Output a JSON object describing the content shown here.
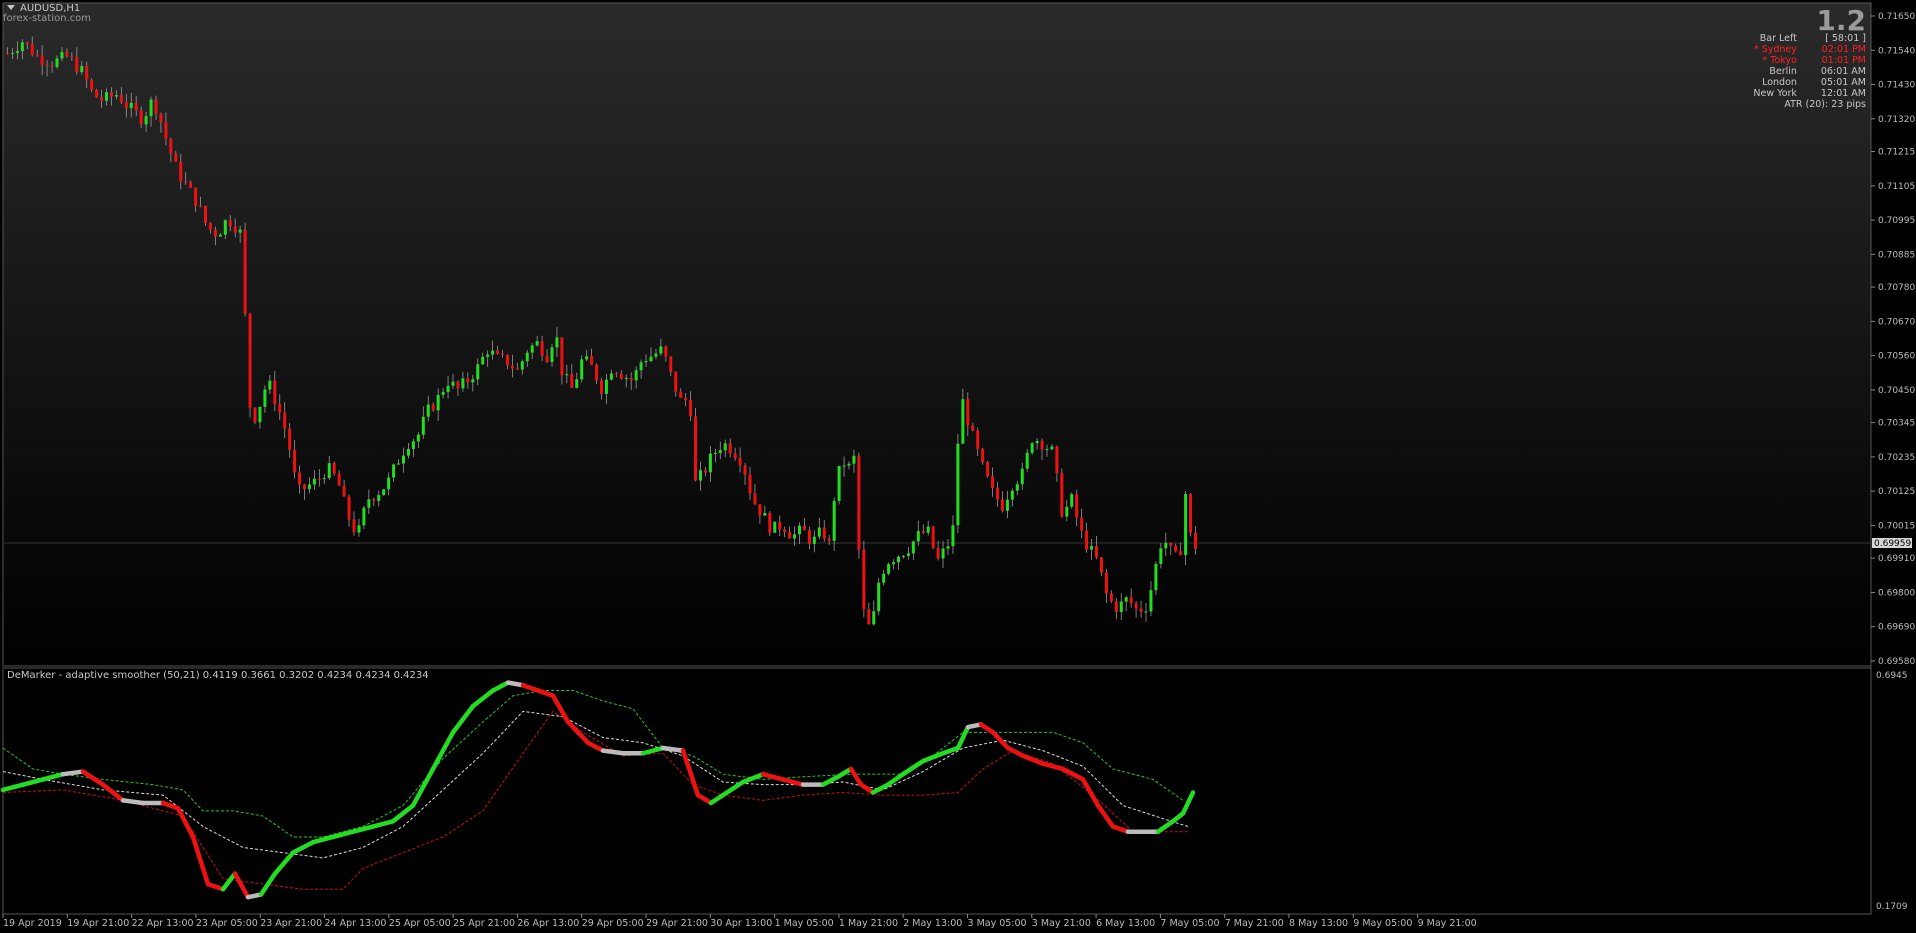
{
  "chart": {
    "symbol": "AUDUSD,H1",
    "source": "forex-station.com",
    "version": "1.2"
  },
  "info_panel": {
    "rows": [
      {
        "label": "Bar Left",
        "value": "[ 58:01 ]",
        "color": "#c8c8c8"
      },
      {
        "label": "* Sydney",
        "value": "02:01 PM",
        "color": "#ff2020"
      },
      {
        "label": "* Tokyo",
        "value": "01:01 PM",
        "color": "#ff2020"
      },
      {
        "label": "Berlin",
        "value": "06:01 AM",
        "color": "#c8c8c8"
      },
      {
        "label": "London",
        "value": "05:01 AM",
        "color": "#c8c8c8"
      },
      {
        "label": "New York",
        "value": "12:01 AM",
        "color": "#c8c8c8"
      }
    ],
    "atr": "ATR (20): 23 pips"
  },
  "indicator": {
    "label": "DeMarker - adaptive smoother (50,21) 0.4119 0.3661 0.3202 0.4234 0.4234 0.4234",
    "scale_top": "0.6945",
    "scale_bottom": "0.1709"
  },
  "price_axis": {
    "labels": [
      "0.71650",
      "0.71540",
      "0.71430",
      "0.71320",
      "0.71215",
      "0.71105",
      "0.70995",
      "0.70885",
      "0.70780",
      "0.70670",
      "0.70560",
      "0.70450",
      "0.70345",
      "0.70235",
      "0.70125",
      "0.70015",
      "0.69910",
      "0.69800",
      "0.69690",
      "0.69580"
    ],
    "current_price": "0.69959"
  },
  "time_axis": {
    "labels": [
      "19 Apr 2019",
      "19 Apr 21:00",
      "22 Apr 13:00",
      "23 Apr 05:00",
      "23 Apr 21:00",
      "24 Apr 13:00",
      "25 Apr 05:00",
      "25 Apr 21:00",
      "26 Apr 13:00",
      "29 Apr 05:00",
      "29 Apr 21:00",
      "30 Apr 13:00",
      "1 May 05:00",
      "1 May 21:00",
      "2 May 13:00",
      "3 May 05:00",
      "3 May 21:00",
      "6 May 13:00",
      "7 May 05:00",
      "7 May 21:00",
      "8 May 13:00",
      "9 May 05:00",
      "9 May 21:00"
    ]
  },
  "colors": {
    "bull": "#22dd22",
    "bear": "#ee1111",
    "neutral_line": "#bbbbbb",
    "background_top": "#2a2a2a",
    "background_bottom": "#000000"
  },
  "chart_data": {
    "type": "candlestick",
    "close_path": [
      [
        0,
        0.7153
      ],
      [
        15,
        0.7157
      ],
      [
        30,
        0.7152
      ],
      [
        45,
        0.715
      ],
      [
        60,
        0.7152
      ],
      [
        75,
        0.7147
      ],
      [
        85,
        0.714
      ],
      [
        95,
        0.7138
      ],
      [
        110,
        0.714
      ],
      [
        120,
        0.7136
      ],
      [
        135,
        0.7132
      ],
      [
        145,
        0.7138
      ],
      [
        150,
        0.7135
      ],
      [
        160,
        0.7124
      ],
      [
        170,
        0.7115
      ],
      [
        180,
        0.711
      ],
      [
        190,
        0.7105
      ],
      [
        200,
        0.7097
      ],
      [
        210,
        0.7095
      ],
      [
        220,
        0.71
      ],
      [
        230,
        0.7097
      ],
      [
        235,
        0.7094
      ],
      [
        240,
        0.7045
      ],
      [
        245,
        0.7035
      ],
      [
        250,
        0.7038
      ],
      [
        260,
        0.7048
      ],
      [
        270,
        0.704
      ],
      [
        280,
        0.703
      ],
      [
        290,
        0.7012
      ],
      [
        300,
        0.7014
      ],
      [
        310,
        0.7016
      ],
      [
        320,
        0.702
      ],
      [
        330,
        0.7016
      ],
      [
        340,
        0.7005
      ],
      [
        350,
        0.6998
      ],
      [
        360,
        0.701
      ],
      [
        370,
        0.7012
      ],
      [
        380,
        0.7015
      ],
      [
        390,
        0.7022
      ],
      [
        400,
        0.7028
      ],
      [
        410,
        0.703
      ],
      [
        420,
        0.7038
      ],
      [
        430,
        0.7042
      ],
      [
        440,
        0.7048
      ],
      [
        450,
        0.7045
      ],
      [
        460,
        0.7048
      ],
      [
        470,
        0.7052
      ],
      [
        480,
        0.7058
      ],
      [
        490,
        0.7055
      ],
      [
        500,
        0.7054
      ],
      [
        510,
        0.7051
      ],
      [
        520,
        0.7058
      ],
      [
        530,
        0.706
      ],
      [
        540,
        0.7056
      ],
      [
        548,
        0.7064
      ],
      [
        555,
        0.705
      ],
      [
        565,
        0.7045
      ],
      [
        575,
        0.7055
      ],
      [
        585,
        0.7052
      ],
      [
        595,
        0.7045
      ],
      [
        605,
        0.7053
      ],
      [
        615,
        0.705
      ],
      [
        625,
        0.7048
      ],
      [
        635,
        0.7055
      ],
      [
        645,
        0.7056
      ],
      [
        655,
        0.7058
      ],
      [
        665,
        0.7048
      ],
      [
        675,
        0.704
      ],
      [
        682,
        0.7044
      ],
      [
        688,
        0.7015
      ],
      [
        695,
        0.7018
      ],
      [
        705,
        0.7024
      ],
      [
        715,
        0.7028
      ],
      [
        725,
        0.7026
      ],
      [
        735,
        0.7022
      ],
      [
        745,
        0.701
      ],
      [
        755,
        0.7005
      ],
      [
        765,
        0.7
      ],
      [
        775,
        0.7002
      ],
      [
        785,
        0.6998
      ],
      [
        795,
        0.7
      ],
      [
        805,
        0.6996
      ],
      [
        815,
        0.7
      ],
      [
        822,
        0.6995
      ],
      [
        828,
        0.7015
      ],
      [
        835,
        0.7022
      ],
      [
        842,
        0.702
      ],
      [
        848,
        0.7024
      ],
      [
        852,
        0.6988
      ],
      [
        858,
        0.6968
      ],
      [
        865,
        0.697
      ],
      [
        872,
        0.6985
      ],
      [
        880,
        0.699
      ],
      [
        890,
        0.6992
      ],
      [
        900,
        0.6994
      ],
      [
        910,
        0.6998
      ],
      [
        920,
        0.7
      ],
      [
        930,
        0.699
      ],
      [
        940,
        0.6995
      ],
      [
        948,
        0.7003
      ],
      [
        952,
        0.7045
      ],
      [
        958,
        0.7038
      ],
      [
        965,
        0.703
      ],
      [
        975,
        0.702
      ],
      [
        985,
        0.7012
      ],
      [
        995,
        0.7008
      ],
      [
        1005,
        0.7015
      ],
      [
        1015,
        0.7018
      ],
      [
        1025,
        0.703
      ],
      [
        1035,
        0.7028
      ],
      [
        1045,
        0.7025
      ],
      [
        1055,
        0.7005
      ],
      [
        1065,
        0.701
      ],
      [
        1072,
        0.7
      ],
      [
        1080,
        0.6995
      ],
      [
        1090,
        0.699
      ],
      [
        1100,
        0.6978
      ],
      [
        1110,
        0.6975
      ],
      [
        1120,
        0.6978
      ],
      [
        1130,
        0.6974
      ],
      [
        1140,
        0.6976
      ],
      [
        1148,
        0.6988
      ],
      [
        1155,
        0.6998
      ],
      [
        1165,
        0.6992
      ],
      [
        1172,
        0.699
      ],
      [
        1178,
        0.7012
      ],
      [
        1183,
        0.6998
      ],
      [
        1188,
        0.6995
      ]
    ]
  },
  "demarker_data": {
    "main_line": [
      [
        0,
        0.59
      ],
      [
        20,
        0.6
      ],
      [
        40,
        0.61
      ],
      [
        60,
        0.62
      ],
      [
        80,
        0.625
      ],
      [
        100,
        0.6
      ],
      [
        120,
        0.57
      ],
      [
        140,
        0.565
      ],
      [
        160,
        0.565
      ],
      [
        175,
        0.555
      ],
      [
        190,
        0.5
      ],
      [
        205,
        0.41
      ],
      [
        220,
        0.4
      ],
      [
        232,
        0.43
      ],
      [
        245,
        0.385
      ],
      [
        258,
        0.39
      ],
      [
        272,
        0.43
      ],
      [
        290,
        0.47
      ],
      [
        310,
        0.49
      ],
      [
        330,
        0.5
      ],
      [
        350,
        0.51
      ],
      [
        370,
        0.52
      ],
      [
        390,
        0.53
      ],
      [
        410,
        0.56
      ],
      [
        430,
        0.63
      ],
      [
        450,
        0.7
      ],
      [
        470,
        0.75
      ],
      [
        490,
        0.78
      ],
      [
        505,
        0.795
      ],
      [
        520,
        0.79
      ],
      [
        535,
        0.78
      ],
      [
        550,
        0.77
      ],
      [
        565,
        0.72
      ],
      [
        585,
        0.68
      ],
      [
        600,
        0.665
      ],
      [
        620,
        0.66
      ],
      [
        640,
        0.66
      ],
      [
        660,
        0.67
      ],
      [
        680,
        0.665
      ],
      [
        695,
        0.58
      ],
      [
        708,
        0.565
      ],
      [
        720,
        0.58
      ],
      [
        740,
        0.605
      ],
      [
        760,
        0.62
      ],
      [
        780,
        0.61
      ],
      [
        800,
        0.6
      ],
      [
        820,
        0.6
      ],
      [
        835,
        0.615
      ],
      [
        848,
        0.63
      ],
      [
        858,
        0.6
      ],
      [
        870,
        0.585
      ],
      [
        885,
        0.6
      ],
      [
        900,
        0.62
      ],
      [
        920,
        0.645
      ],
      [
        940,
        0.66
      ],
      [
        955,
        0.67
      ],
      [
        965,
        0.71
      ],
      [
        978,
        0.715
      ],
      [
        990,
        0.7
      ],
      [
        1005,
        0.67
      ],
      [
        1020,
        0.655
      ],
      [
        1040,
        0.64
      ],
      [
        1060,
        0.63
      ],
      [
        1080,
        0.61
      ],
      [
        1095,
        0.56
      ],
      [
        1110,
        0.52
      ],
      [
        1125,
        0.51
      ],
      [
        1140,
        0.51
      ],
      [
        1155,
        0.51
      ],
      [
        1170,
        0.53
      ],
      [
        1180,
        0.545
      ],
      [
        1190,
        0.585
      ]
    ],
    "upper_band": [
      [
        0,
        0.67
      ],
      [
        30,
        0.63
      ],
      [
        60,
        0.62
      ],
      [
        100,
        0.61
      ],
      [
        150,
        0.6
      ],
      [
        180,
        0.59
      ],
      [
        200,
        0.55
      ],
      [
        230,
        0.55
      ],
      [
        260,
        0.54
      ],
      [
        290,
        0.5
      ],
      [
        320,
        0.5
      ],
      [
        360,
        0.52
      ],
      [
        400,
        0.56
      ],
      [
        440,
        0.65
      ],
      [
        480,
        0.72
      ],
      [
        510,
        0.77
      ],
      [
        540,
        0.78
      ],
      [
        570,
        0.78
      ],
      [
        600,
        0.76
      ],
      [
        630,
        0.745
      ],
      [
        660,
        0.67
      ],
      [
        690,
        0.655
      ],
      [
        720,
        0.62
      ],
      [
        760,
        0.61
      ],
      [
        800,
        0.615
      ],
      [
        850,
        0.62
      ],
      [
        900,
        0.62
      ],
      [
        930,
        0.655
      ],
      [
        960,
        0.7
      ],
      [
        1000,
        0.7
      ],
      [
        1050,
        0.7
      ],
      [
        1080,
        0.68
      ],
      [
        1110,
        0.63
      ],
      [
        1150,
        0.61
      ],
      [
        1180,
        0.57
      ]
    ],
    "mid_band": [
      [
        0,
        0.625
      ],
      [
        40,
        0.61
      ],
      [
        100,
        0.59
      ],
      [
        160,
        0.58
      ],
      [
        200,
        0.52
      ],
      [
        240,
        0.48
      ],
      [
        280,
        0.47
      ],
      [
        320,
        0.46
      ],
      [
        360,
        0.48
      ],
      [
        400,
        0.52
      ],
      [
        440,
        0.59
      ],
      [
        480,
        0.66
      ],
      [
        520,
        0.74
      ],
      [
        560,
        0.73
      ],
      [
        600,
        0.69
      ],
      [
        640,
        0.68
      ],
      [
        680,
        0.655
      ],
      [
        720,
        0.605
      ],
      [
        760,
        0.6
      ],
      [
        800,
        0.6
      ],
      [
        840,
        0.605
      ],
      [
        880,
        0.59
      ],
      [
        920,
        0.625
      ],
      [
        960,
        0.67
      ],
      [
        1000,
        0.685
      ],
      [
        1040,
        0.665
      ],
      [
        1080,
        0.635
      ],
      [
        1120,
        0.56
      ],
      [
        1160,
        0.535
      ],
      [
        1185,
        0.52
      ]
    ],
    "lower_band": [
      [
        0,
        0.585
      ],
      [
        60,
        0.59
      ],
      [
        120,
        0.57
      ],
      [
        180,
        0.54
      ],
      [
        220,
        0.42
      ],
      [
        260,
        0.41
      ],
      [
        300,
        0.4
      ],
      [
        340,
        0.4
      ],
      [
        360,
        0.44
      ],
      [
        400,
        0.47
      ],
      [
        440,
        0.5
      ],
      [
        480,
        0.55
      ],
      [
        520,
        0.66
      ],
      [
        550,
        0.74
      ],
      [
        580,
        0.7
      ],
      [
        620,
        0.655
      ],
      [
        660,
        0.66
      ],
      [
        690,
        0.6
      ],
      [
        720,
        0.58
      ],
      [
        760,
        0.57
      ],
      [
        800,
        0.58
      ],
      [
        840,
        0.585
      ],
      [
        880,
        0.58
      ],
      [
        920,
        0.58
      ],
      [
        955,
        0.585
      ],
      [
        980,
        0.63
      ],
      [
        1010,
        0.665
      ],
      [
        1050,
        0.64
      ],
      [
        1090,
        0.58
      ],
      [
        1130,
        0.51
      ],
      [
        1160,
        0.51
      ],
      [
        1185,
        0.51
      ]
    ]
  }
}
